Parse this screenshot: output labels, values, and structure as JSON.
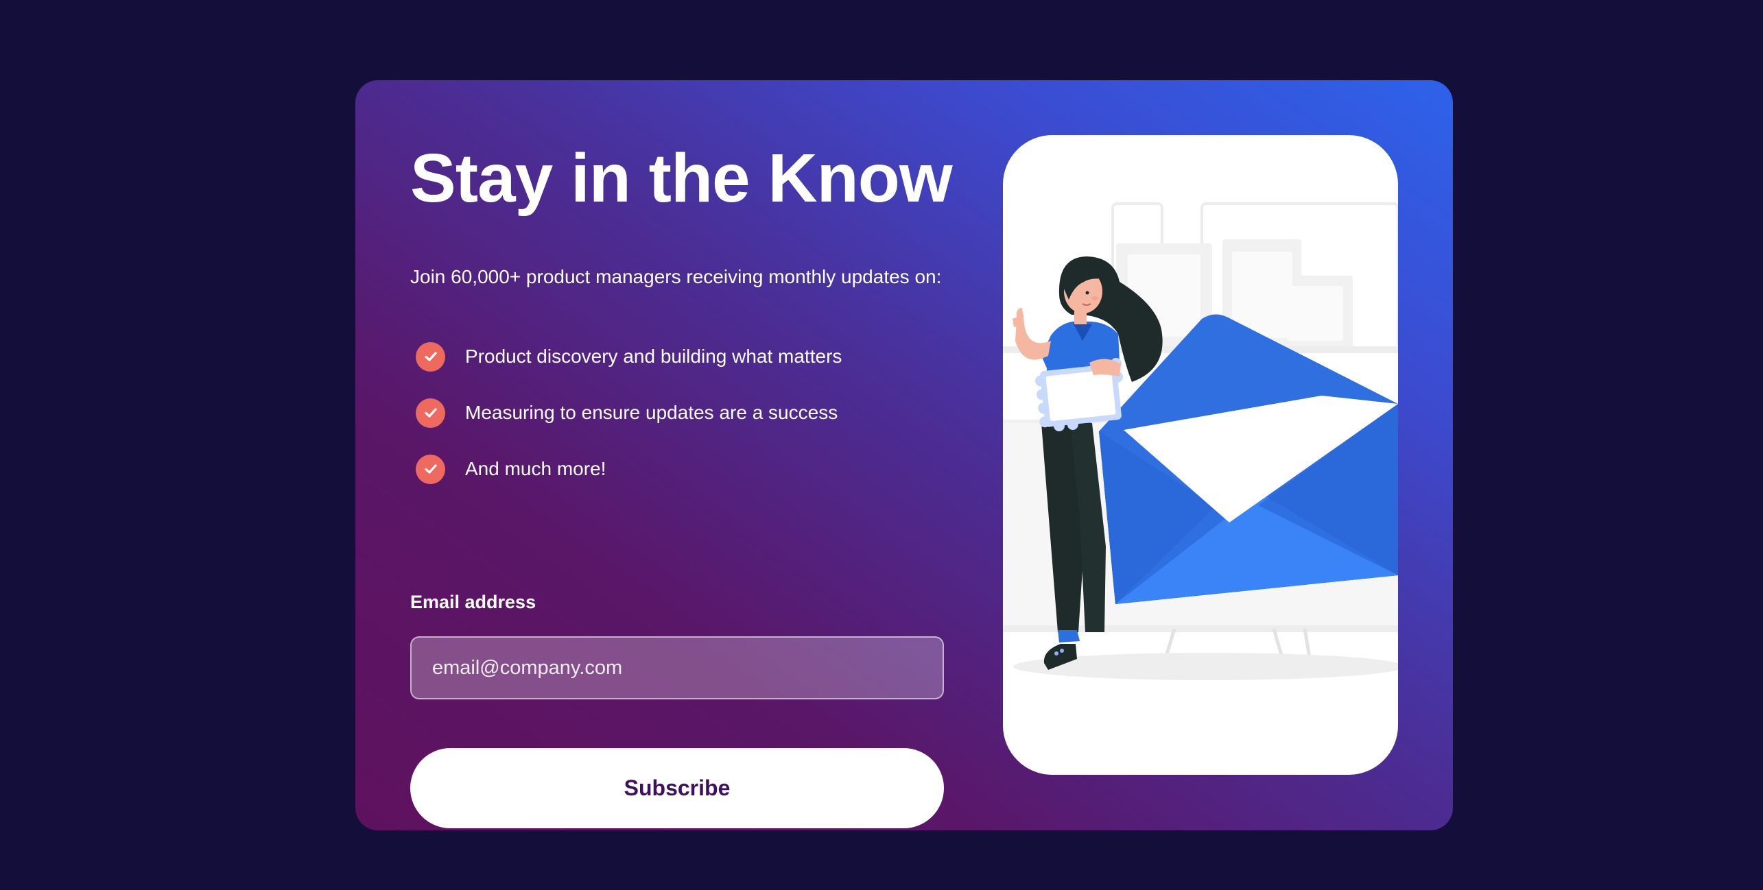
{
  "signup": {
    "title": "Stay in the Know",
    "intro": "Join 60,000+ product managers receiving monthly updates on:",
    "features": [
      "Product discovery and building what matters",
      "Measuring to ensure updates are a success",
      "And much more!"
    ],
    "email_label": "Email address",
    "email_placeholder": "email@company.com",
    "email_value": "",
    "subscribe_label": "Subscribe"
  },
  "illustration": {
    "subject": "woman holding a letter next to a large blue open envelope"
  },
  "colors": {
    "page_background": "#140e3a",
    "gradient_start": "#5e125e",
    "gradient_end": "#2d62ea",
    "check_badge": "#ee6a5f",
    "button_text": "#3d1160",
    "envelope_blue": "#3379f5"
  },
  "icons": {
    "list_bullet": "check-circle-icon"
  }
}
